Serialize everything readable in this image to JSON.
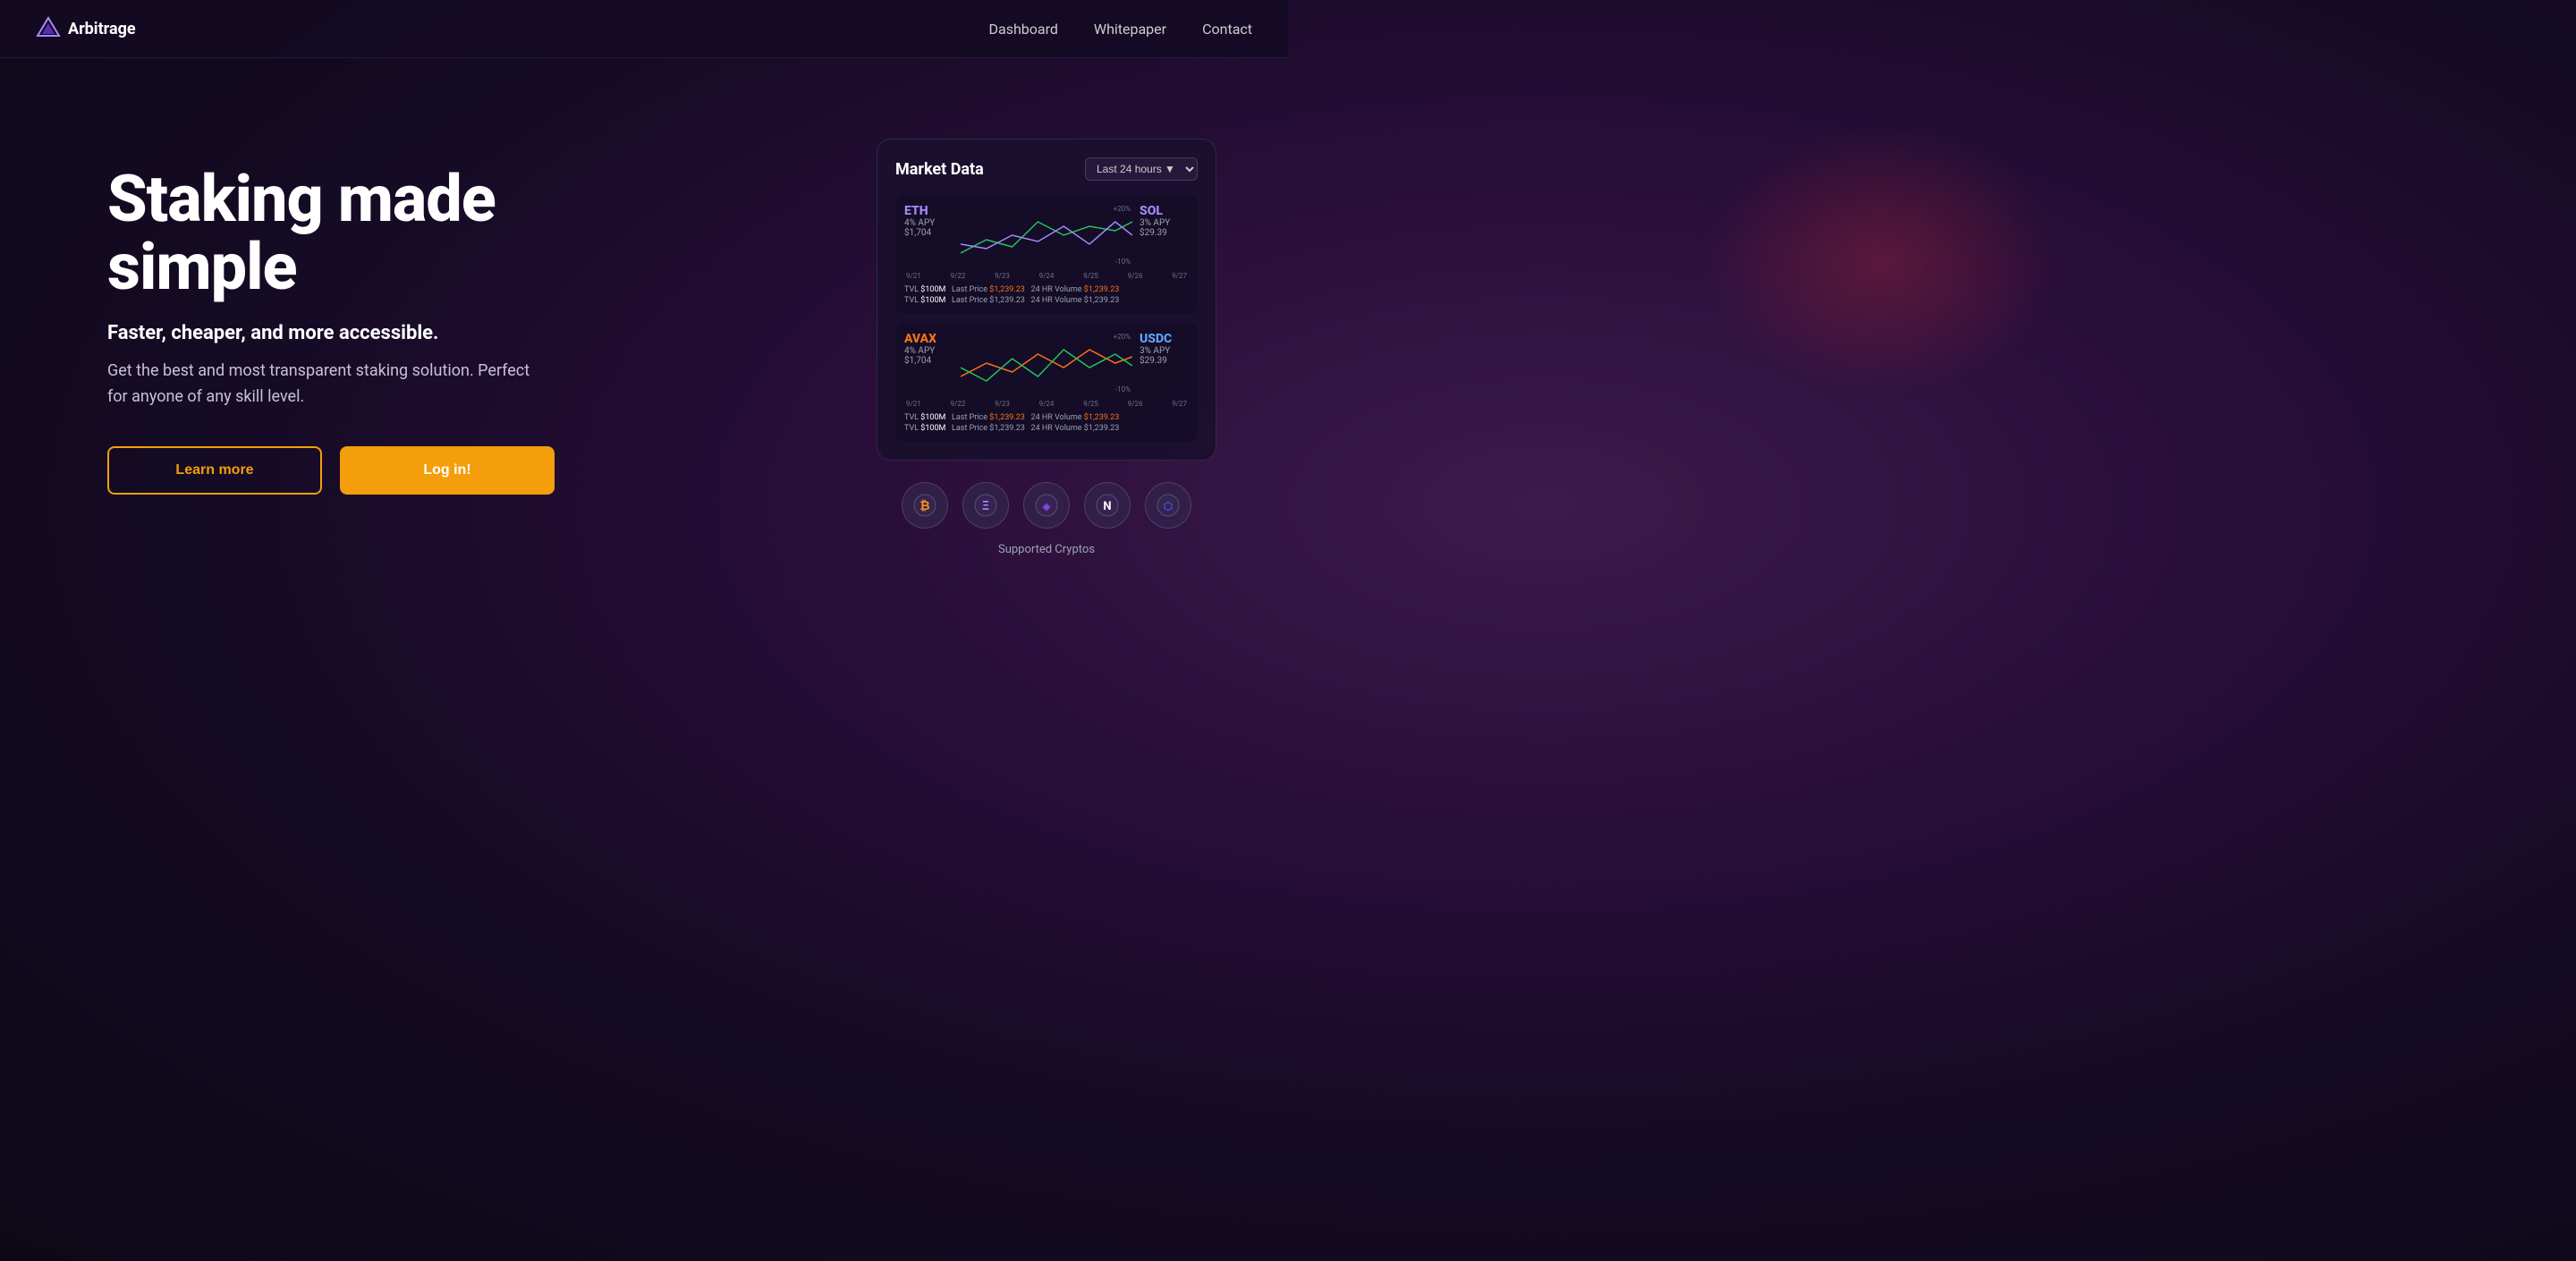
{
  "nav": {
    "logo_text": "Arbitrage",
    "links": [
      {
        "label": "Dashboard",
        "name": "nav-dashboard"
      },
      {
        "label": "Whitepaper",
        "name": "nav-whitepaper"
      },
      {
        "label": "Contact",
        "name": "nav-contact"
      }
    ]
  },
  "hero": {
    "title": "Staking made simple",
    "subtitle": "Faster, cheaper, and more accessible.",
    "description": "Get the best and most transparent staking solution. Perfect for anyone of any skill level.",
    "btn_learn": "Learn more",
    "btn_login": "Log in!"
  },
  "market_data": {
    "title": "Market Data",
    "dropdown_label": "Last 24 hours",
    "tokens": [
      {
        "name": "ETH",
        "apy": "4% APY",
        "price": "$1,704",
        "color_class": "eth",
        "tvl": "$100M",
        "last_price": "$1,239.23",
        "volume_24hr": "$1,239.23"
      },
      {
        "name": "SOL",
        "apy": "3% APY",
        "price": "$29.39",
        "color_class": "sol",
        "tvl": "$100M",
        "last_price": "$1,239.23",
        "volume_24hr": "$1,239.23"
      },
      {
        "name": "AVAX",
        "apy": "4% APY",
        "price": "$1,704",
        "color_class": "avax",
        "tvl": "$100M",
        "last_price": "$1,239.23",
        "volume_24hr": "$1,239.23"
      },
      {
        "name": "USDC",
        "apy": "3% APY",
        "price": "$29.39",
        "color_class": "usdc",
        "tvl": "$100M",
        "last_price": "$1,239.23",
        "volume_24hr": "$1,239.23"
      }
    ],
    "dates": [
      "9/21",
      "9/22",
      "9/23",
      "9/24",
      "9/25",
      "9/26",
      "9/27"
    ]
  },
  "supported_cryptos": {
    "label": "Supported Cryptos",
    "icons": [
      "₿",
      "Ξ",
      "◈",
      "Ν",
      "∞"
    ]
  }
}
